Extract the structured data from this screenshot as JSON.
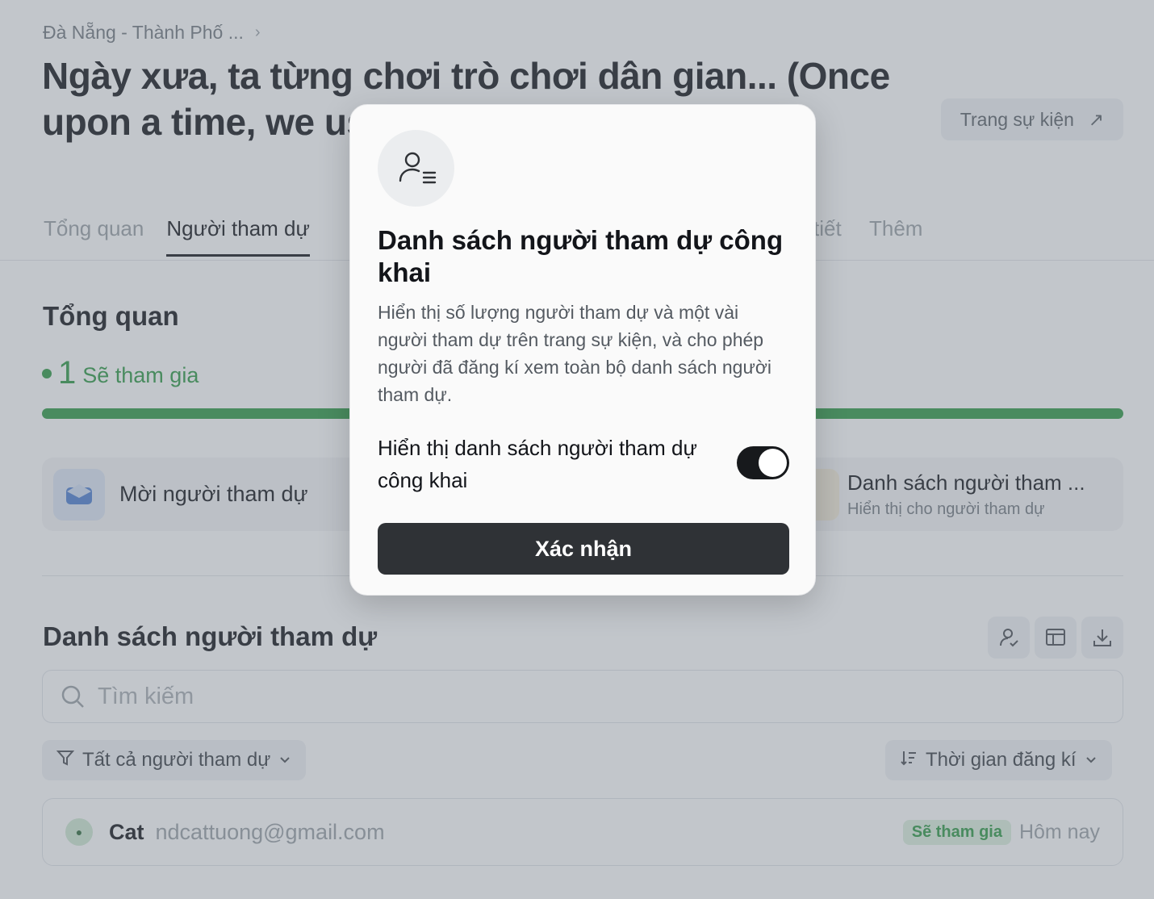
{
  "breadcrumb": {
    "location": "Đà Nẵng - Thành Phố ...",
    "chevron": "›"
  },
  "event": {
    "title": "Ngày xưa, ta từng chơi trò chơi dân gian... (Once upon a time, we used to play folk games...)",
    "page_button": "Trang sự kiện",
    "page_button_icon": "↗"
  },
  "tabs": [
    "Tổng quan",
    "Người tham dự",
    "tiết",
    "Thêm"
  ],
  "overview": {
    "title": "Tổng quan",
    "going_count": "1",
    "going_label": "Sẽ tham gia",
    "progress": 1.0,
    "accent_color": "#2f9a45"
  },
  "cards": {
    "invite_label": "Mời người tham dự",
    "list_title": "Danh sách người tham ...",
    "list_subtitle": "Hiển thị cho người tham dự"
  },
  "guest_list": {
    "title": "Danh sách người tham dự",
    "search_placeholder": "Tìm kiếm",
    "filter_label": "Tất cả người tham dự",
    "sort_label": "Thời gian đăng kí",
    "rows": [
      {
        "name": "Cat",
        "email": "ndcattuong@gmail.com",
        "status": "Sẽ tham gia",
        "date": "Hôm nay"
      }
    ]
  },
  "modal": {
    "title": "Danh sách người tham dự công khai",
    "description": "Hiển thị số lượng người tham dự và một vài người tham dự trên trang sự kiện, và cho phép người đã đăng kí xem toàn bộ danh sách người tham dự.",
    "toggle_label": "Hiển thị danh sách người tham dự công khai",
    "toggle_on": true,
    "confirm_label": "Xác nhận"
  }
}
